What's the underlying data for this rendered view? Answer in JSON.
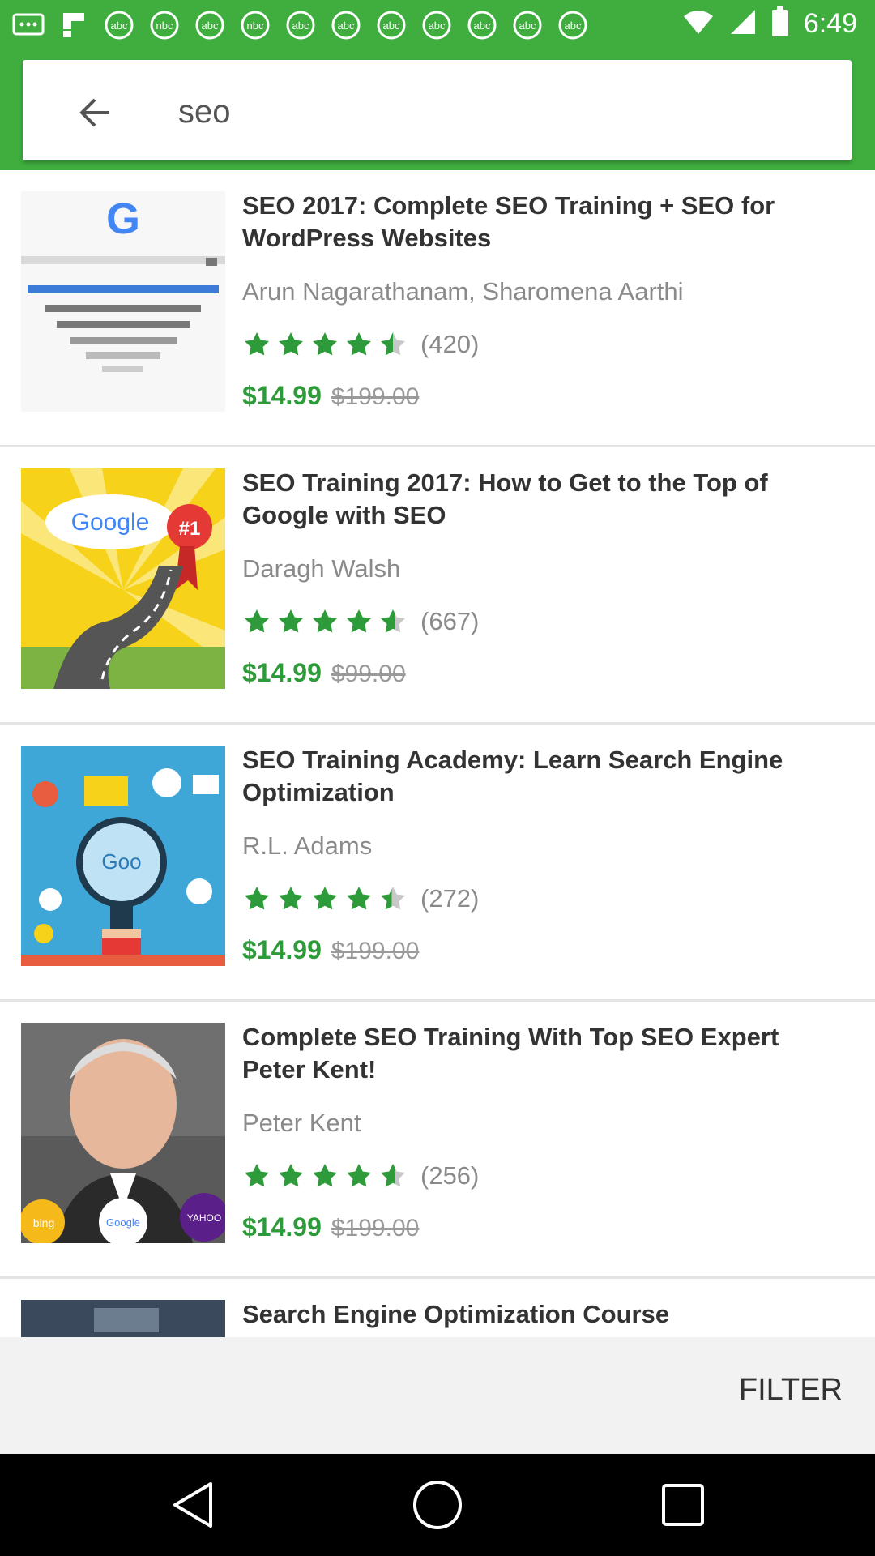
{
  "status_bar": {
    "time": "6:49",
    "notification_icons": [
      "message-icon",
      "flipboard-icon",
      "browser-icon",
      "browser-icon",
      "browser-icon",
      "browser-icon",
      "browser-icon",
      "browser-icon",
      "browser-icon",
      "browser-icon",
      "browser-icon",
      "browser-icon"
    ]
  },
  "search": {
    "query": "seo"
  },
  "courses": [
    {
      "title": "SEO 2017: Complete SEO Training + SEO for WordPress Websites",
      "author": "Arun Nagarathanam, Sharomena Aarthi",
      "rating": 4.5,
      "review_count": "(420)",
      "price": "$14.99",
      "original_price": "$199.00"
    },
    {
      "title": "SEO Training 2017: How to Get to the Top of Google with SEO",
      "author": "Daragh Walsh",
      "rating": 4.5,
      "review_count": "(667)",
      "price": "$14.99",
      "original_price": "$99.00"
    },
    {
      "title": "SEO Training Academy: Learn Search Engine Optimization",
      "author": "R.L. Adams",
      "rating": 4.5,
      "review_count": "(272)",
      "price": "$14.99",
      "original_price": "$199.00"
    },
    {
      "title": "Complete SEO Training With Top SEO Expert Peter Kent!",
      "author": "Peter Kent",
      "rating": 4.5,
      "review_count": "(256)",
      "price": "$14.99",
      "original_price": "$199.00"
    },
    {
      "title": "Search Engine Optimization Course",
      "author": "",
      "rating": null,
      "review_count": "",
      "price": "",
      "original_price": ""
    }
  ],
  "footer": {
    "filter_label": "FILTER"
  },
  "colors": {
    "accent_green": "#3fae3f",
    "price_green": "#2e9b3a",
    "star_green": "#2e9b3a"
  }
}
